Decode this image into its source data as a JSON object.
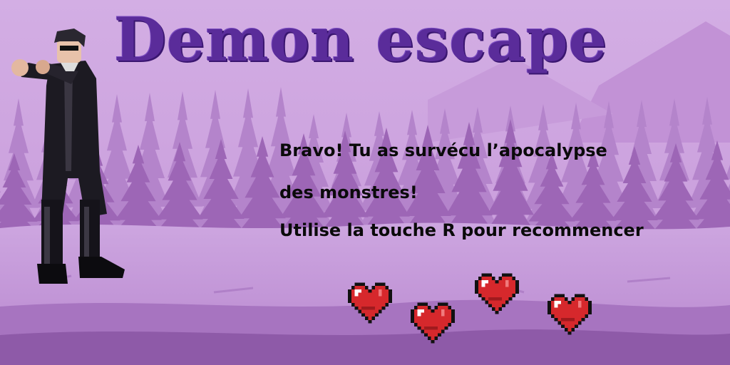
{
  "game": {
    "title": "Demon escape",
    "message_lines": [
      "Bravo! Tu as survécu l’apocalypse",
      "des monstres!",
      "Utilise la touche R pour recommencer"
    ],
    "restart_key": "R",
    "lives": 4
  },
  "colors": {
    "sky": "#c9a0dc",
    "trees_far": "#b07ec8",
    "trees_near": "#9a62b4",
    "ground": "#c8a0dc",
    "title": "#5a2c9a",
    "heart": "#d6282c"
  },
  "icons": {
    "player": "player-character-sprite",
    "life": "pixel-heart-icon"
  }
}
